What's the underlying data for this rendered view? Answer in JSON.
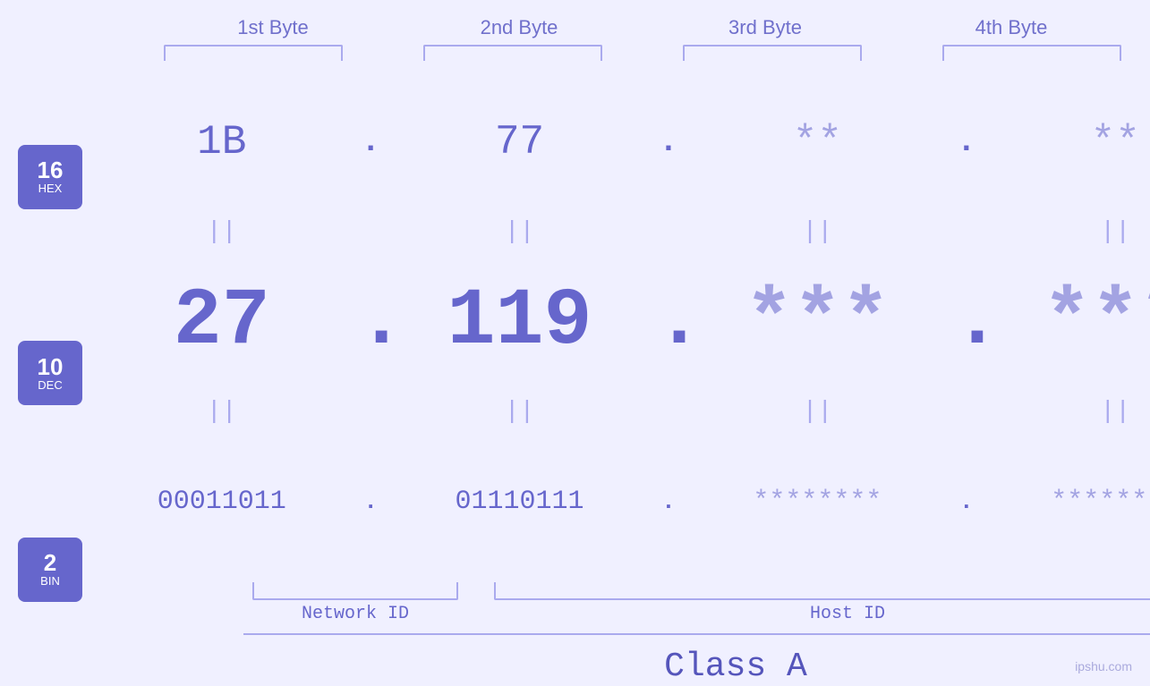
{
  "header": {
    "bytes": [
      "1st Byte",
      "2nd Byte",
      "3rd Byte",
      "4th Byte"
    ]
  },
  "badges": [
    {
      "num": "16",
      "base": "HEX"
    },
    {
      "num": "10",
      "base": "DEC"
    },
    {
      "num": "2",
      "base": "BIN"
    }
  ],
  "hex_row": {
    "values": [
      "1B",
      "77",
      "**",
      "**"
    ],
    "dots": [
      ".",
      ".",
      "."
    ]
  },
  "dec_row": {
    "values": [
      "27",
      "119.",
      "***.",
      "***"
    ],
    "dots": [
      ".",
      ".",
      "."
    ]
  },
  "bin_row": {
    "values": [
      "00011011",
      "01110111",
      "********",
      "********"
    ],
    "dots": [
      ".",
      ".",
      "."
    ]
  },
  "equals": [
    "||",
    "||",
    "||",
    "||"
  ],
  "labels": {
    "network_id": "Network ID",
    "host_id": "Host ID",
    "class": "Class A"
  },
  "watermark": "ipshu.com"
}
